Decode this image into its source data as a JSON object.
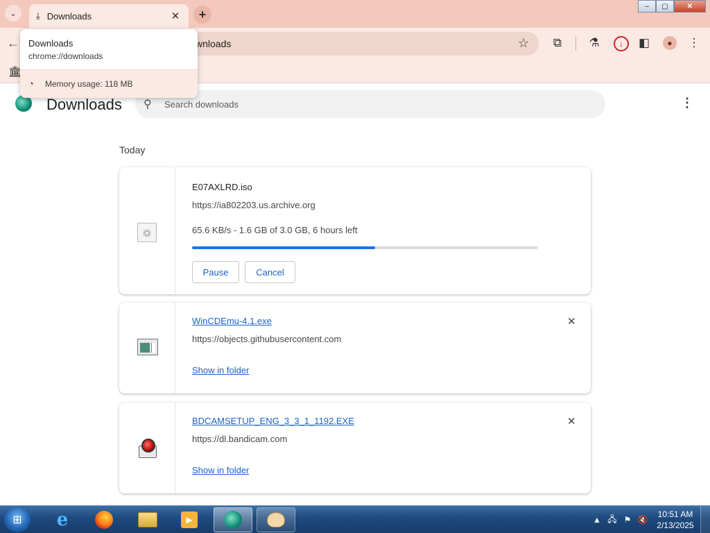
{
  "window": {
    "tab_title": "Downloads",
    "controls": {
      "minimize": "–",
      "maximize": "▢",
      "close": "✕"
    }
  },
  "hovercard": {
    "title": "Downloads",
    "url": "chrome://downloads",
    "memory": "Memory usage: 118 MB"
  },
  "toolbar": {
    "url_visible": "wnloads"
  },
  "page": {
    "title": "Downloads",
    "search_placeholder": "Search downloads",
    "section": "Today"
  },
  "downloads": [
    {
      "name": "E07AXLRD.iso",
      "source": "https://ia802203.us.archive.org",
      "status": "65.6 KB/s - 1.6 GB of 3.0 GB, 6 hours left",
      "progress": 0.53,
      "pause_label": "Pause",
      "cancel_label": "Cancel",
      "icon": "iso-file-icon"
    },
    {
      "name": "WinCDEmu-4.1.exe",
      "source": "https://objects.githubusercontent.com",
      "action": "Show in folder",
      "icon": "exe-file-icon"
    },
    {
      "name": "BDCAMSETUP_ENG_3_3_1_1192.EXE",
      "source": "https://dl.bandicam.com",
      "action": "Show in folder",
      "icon": "bandicam-icon"
    }
  ],
  "taskbar": {
    "apps": [
      "internet-explorer",
      "firefox",
      "file-explorer",
      "media-player",
      "browser-active",
      "paint"
    ],
    "time": "10:51 AM",
    "date": "2/13/2025"
  },
  "colors": {
    "tabstrip": "#f3c9bd",
    "toolbar": "#fbe9e3",
    "link": "#1a63c9",
    "progress": "#1a73e8",
    "taskbar": "#1e4a7d"
  }
}
